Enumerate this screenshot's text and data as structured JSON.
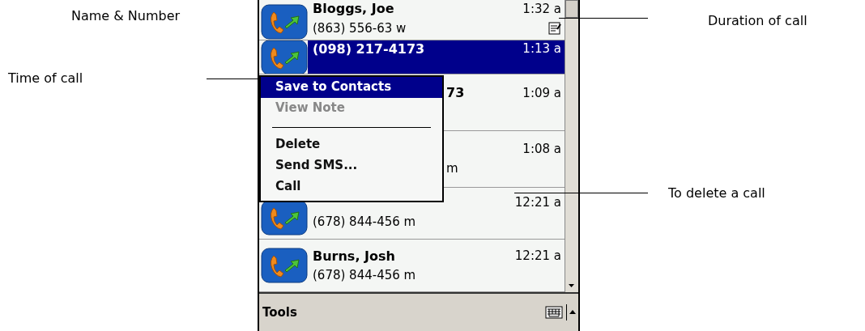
{
  "annotations": [
    {
      "text": "Name & Number",
      "kind": "plain"
    },
    {
      "text": "Time of call",
      "kind": "left-line"
    },
    {
      "text": "Duration of call",
      "kind": "right-line"
    },
    {
      "text": "To delete a call",
      "kind": "right-line"
    }
  ],
  "call_log": [
    {
      "name": "Bloggs, Joe",
      "number": "(863) 556-63 w",
      "time": "1:32 a",
      "note": true,
      "selected": false,
      "under_menu": false
    },
    {
      "name": "(098) 217-4173",
      "time": "1:13 a",
      "note": false,
      "selected": true,
      "under_menu": false
    },
    {
      "name": "73",
      "time": "1:09 a",
      "note": false,
      "selected": false,
      "under_menu": true
    },
    {
      "number": "m",
      "time": "1:08 a",
      "note": false,
      "selected": false,
      "under_menu": true
    },
    {
      "number": "(678) 844-456 m",
      "time": "12:21 a",
      "note": false,
      "selected": false,
      "under_menu": false
    },
    {
      "name": "Burns, Josh",
      "number": "(678) 844-456 m",
      "time": "12:21 a",
      "note": false,
      "selected": false,
      "under_menu": false
    }
  ],
  "context_menu": [
    {
      "kind": "item",
      "label": "Save to Contacts",
      "selected": true,
      "disabled": false
    },
    {
      "kind": "item",
      "label": "View Note",
      "selected": false,
      "disabled": true
    },
    {
      "kind": "separator"
    },
    {
      "kind": "item",
      "label": "Delete",
      "selected": false,
      "disabled": false
    },
    {
      "kind": "item",
      "label": "Send SMS...",
      "selected": false,
      "disabled": false
    },
    {
      "kind": "item",
      "label": "Call",
      "selected": false,
      "disabled": false
    }
  ],
  "menu_bar": {
    "label": "Tools"
  }
}
